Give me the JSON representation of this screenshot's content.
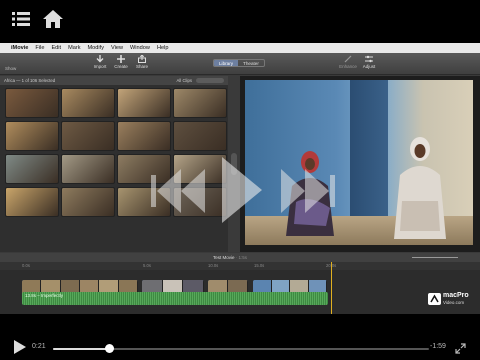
{
  "player": {
    "elapsed": "0:21",
    "remaining": "-1:59",
    "progress": 0.15,
    "icons": [
      "list-icon",
      "home-icon",
      "rewind-icon",
      "play-icon",
      "fast-forward-icon",
      "expand-icon"
    ]
  },
  "menubar": [
    "iMovie",
    "File",
    "Edit",
    "Mark",
    "Modify",
    "View",
    "Window",
    "Help"
  ],
  "toolbar": {
    "show": "Show",
    "import": "Import",
    "create": "Create",
    "share": "Share",
    "library": "Library",
    "theater": "Theater",
    "enhance": "Enhance",
    "adjust": "Adjust"
  },
  "browser": {
    "title": "Africa — 1 of 106 Selected",
    "filter": "All Clips"
  },
  "timeline": {
    "title": "Test Movie",
    "duration": "· 1:5s",
    "ruler": [
      "0.0s",
      "5.0s",
      "10.0s",
      "15.0s",
      "20.0s"
    ],
    "music_label": "13.8s – Imperfectly"
  },
  "logo": {
    "name": "macPro",
    "sub": "Video.com"
  },
  "colors": {
    "accent": "#6d7fa0",
    "playhead": "#e0b020",
    "music": "#3e8a42"
  }
}
